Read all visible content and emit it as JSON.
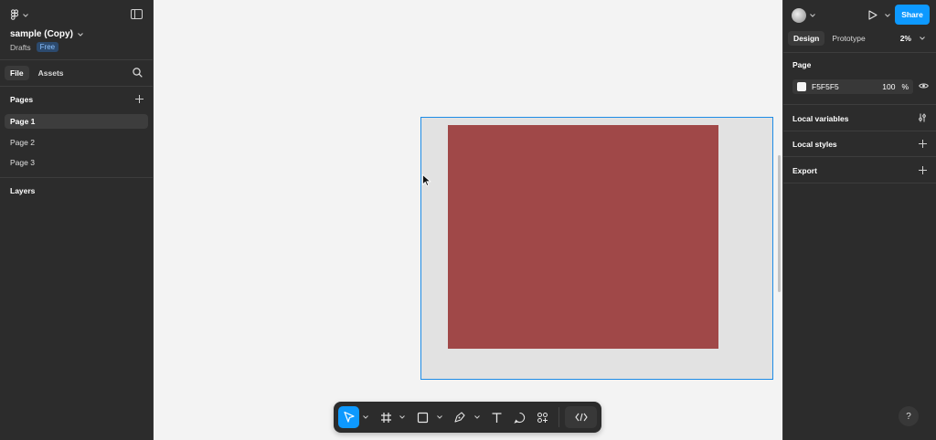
{
  "file": {
    "name": "sample (Copy)",
    "location": "Drafts",
    "plan_badge": "Free"
  },
  "left_tabs": [
    {
      "label": "File"
    },
    {
      "label": "Assets"
    }
  ],
  "pages": {
    "title": "Pages",
    "items": [
      {
        "label": "Page 1"
      },
      {
        "label": "Page 2"
      },
      {
        "label": "Page 3"
      }
    ]
  },
  "layers": {
    "title": "Layers"
  },
  "right": {
    "share_label": "Share",
    "tabs": [
      {
        "label": "Design"
      },
      {
        "label": "Prototype"
      }
    ],
    "zoom": "2%",
    "page_section": {
      "title": "Page",
      "fill_hex": "F5F5F5",
      "opacity": "100",
      "percent_sign": "%"
    },
    "local_variables": "Local variables",
    "local_styles": "Local styles",
    "export": "Export",
    "help": "?"
  },
  "canvas": {
    "frame_fill": "#e2e2e2",
    "rect_fill": "#a04848",
    "selection_color": "#1e8ce6"
  },
  "toolbar": [
    {
      "name": "move-tool",
      "icon": "cursor-arrow-icon"
    },
    {
      "name": "frame-tool",
      "icon": "hash-frame-icon"
    },
    {
      "name": "shape-tool",
      "icon": "rectangle-icon"
    },
    {
      "name": "pen-tool",
      "icon": "pen-icon"
    },
    {
      "name": "text-tool",
      "icon": "text-T-icon"
    },
    {
      "name": "comment-tool",
      "icon": "speech-bubble-icon"
    },
    {
      "name": "actions-tool",
      "icon": "components-icon"
    },
    {
      "name": "dev-mode-tool",
      "icon": "code-brackets-icon"
    }
  ]
}
